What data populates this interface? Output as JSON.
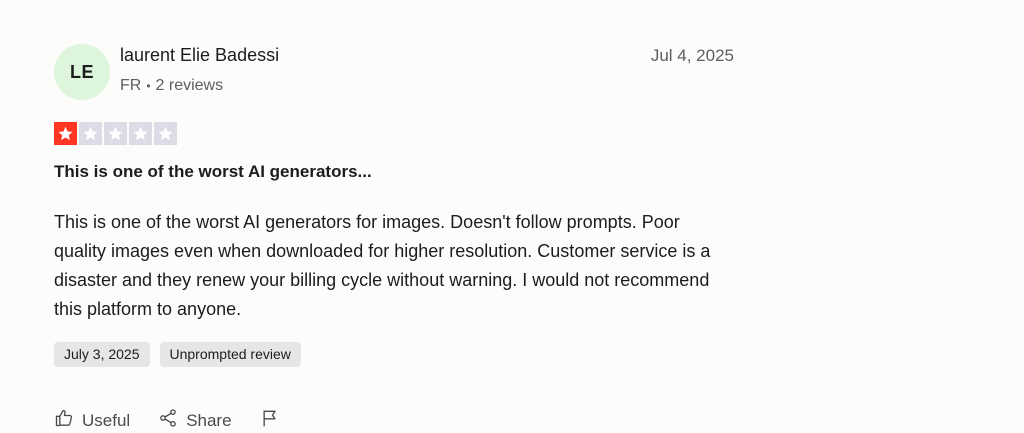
{
  "review": {
    "avatar_initials": "LE",
    "reviewer_name": "laurent Elie Badessi",
    "country": "FR",
    "separator": "•",
    "review_count": "2 reviews",
    "date": "Jul 4, 2025",
    "rating": 1,
    "max_rating": 5,
    "title": "This is one of the worst AI generators...",
    "body": "This is one of the worst AI generators for images. Doesn't follow prompts. Poor quality images even when downloaded for higher resolution. Customer service is a disaster and they renew your billing cycle without warning. I would not recommend this platform to anyone.",
    "tags": {
      "experience_date": "July 3, 2025",
      "source": "Unprompted review"
    },
    "actions": {
      "useful_label": "Useful",
      "share_label": "Share"
    }
  },
  "colors": {
    "star_filled": "#ff3722",
    "star_empty": "#dcdce6",
    "avatar_bg": "#dcf5db"
  },
  "icons": {
    "useful": "thumbs-up-icon",
    "share": "share-icon",
    "report": "flag-icon",
    "star": "star-icon"
  }
}
